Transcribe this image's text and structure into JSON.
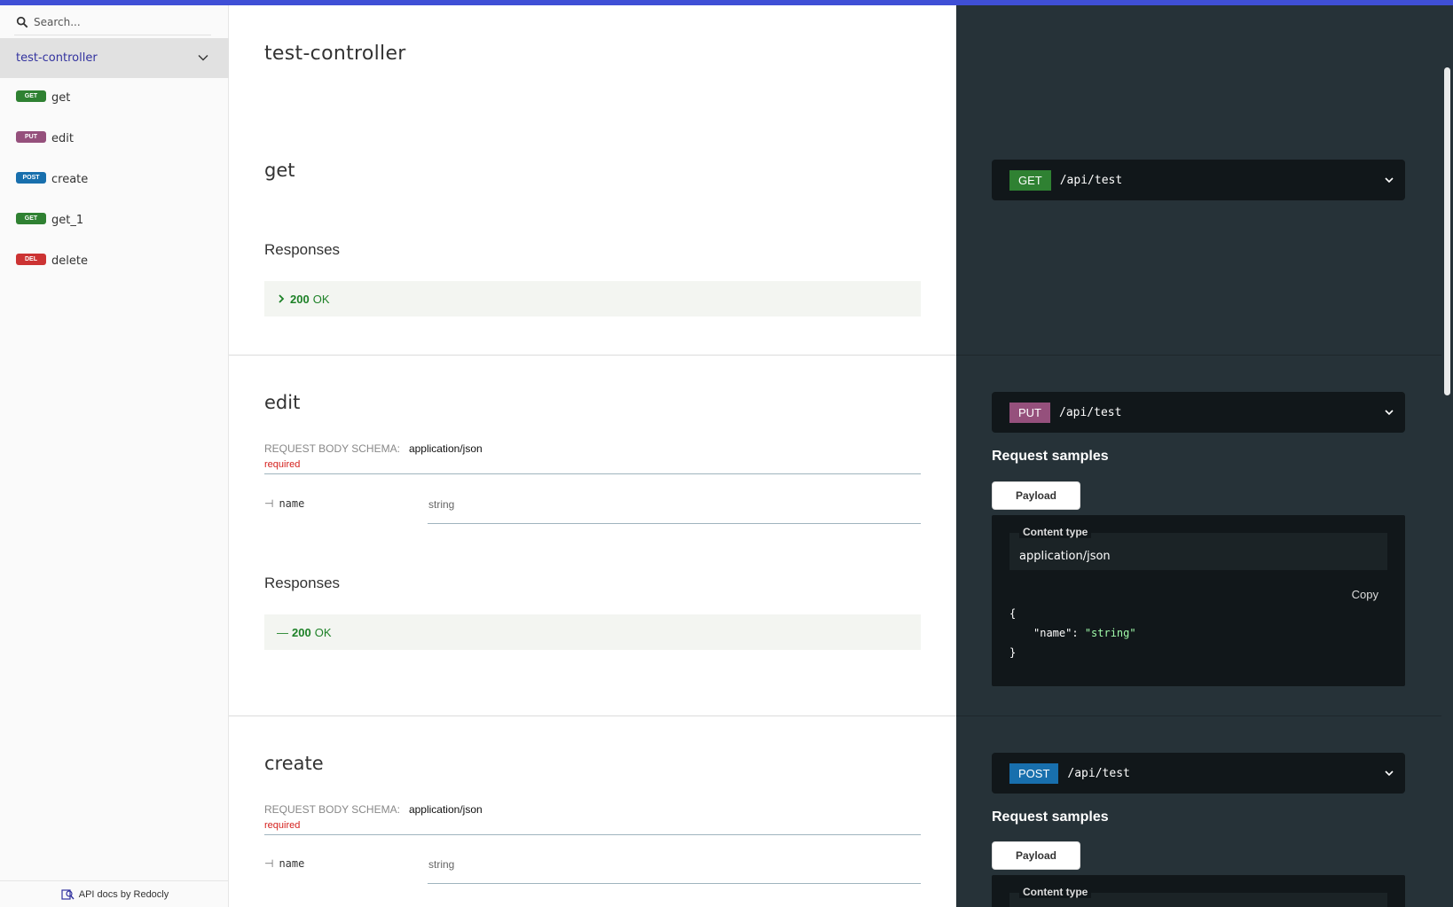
{
  "colors": {
    "accent": "#3f4fd6",
    "get": "#2f8132",
    "put": "#95507c",
    "post": "#186fad",
    "delete": "#cc3333",
    "response_ok": "#1d8127"
  },
  "search": {
    "placeholder": "Search..."
  },
  "sidebar": {
    "group_label": "test-controller",
    "items": [
      {
        "method": "GET",
        "label": "get"
      },
      {
        "method": "PUT",
        "label": "edit"
      },
      {
        "method": "POST",
        "label": "create"
      },
      {
        "method": "GET",
        "label": "get_1"
      },
      {
        "method": "DEL",
        "label": "delete"
      }
    ],
    "footer": "API docs by Redocly"
  },
  "main": {
    "page_title": "test-controller",
    "operations": [
      {
        "title": "get",
        "responses_title": "Responses",
        "response": {
          "code": "200",
          "text": "OK"
        }
      },
      {
        "title": "edit",
        "schema_label": "REQUEST BODY SCHEMA:",
        "schema_type": "application/json",
        "required": "required",
        "prop_name": "name",
        "prop_type": "string",
        "responses_title": "Responses",
        "response": {
          "code": "200",
          "text": "OK"
        }
      },
      {
        "title": "create",
        "schema_label": "REQUEST BODY SCHEMA:",
        "schema_type": "application/json",
        "required": "required",
        "prop_name": "name",
        "prop_type": "string"
      }
    ]
  },
  "right": {
    "endpoints": [
      {
        "method": "GET",
        "path": "/api/test"
      },
      {
        "method": "PUT",
        "path": "/api/test"
      },
      {
        "method": "POST",
        "path": "/api/test"
      }
    ],
    "request_samples_title": "Request samples",
    "payload_tab": "Payload",
    "content_type_label": "Content type",
    "content_type_value": "application/json",
    "copy_label": "Copy",
    "code_open": "{",
    "code_key": "\"name\"",
    "code_colon": ": ",
    "code_value": "\"string\"",
    "code_close": "}"
  }
}
